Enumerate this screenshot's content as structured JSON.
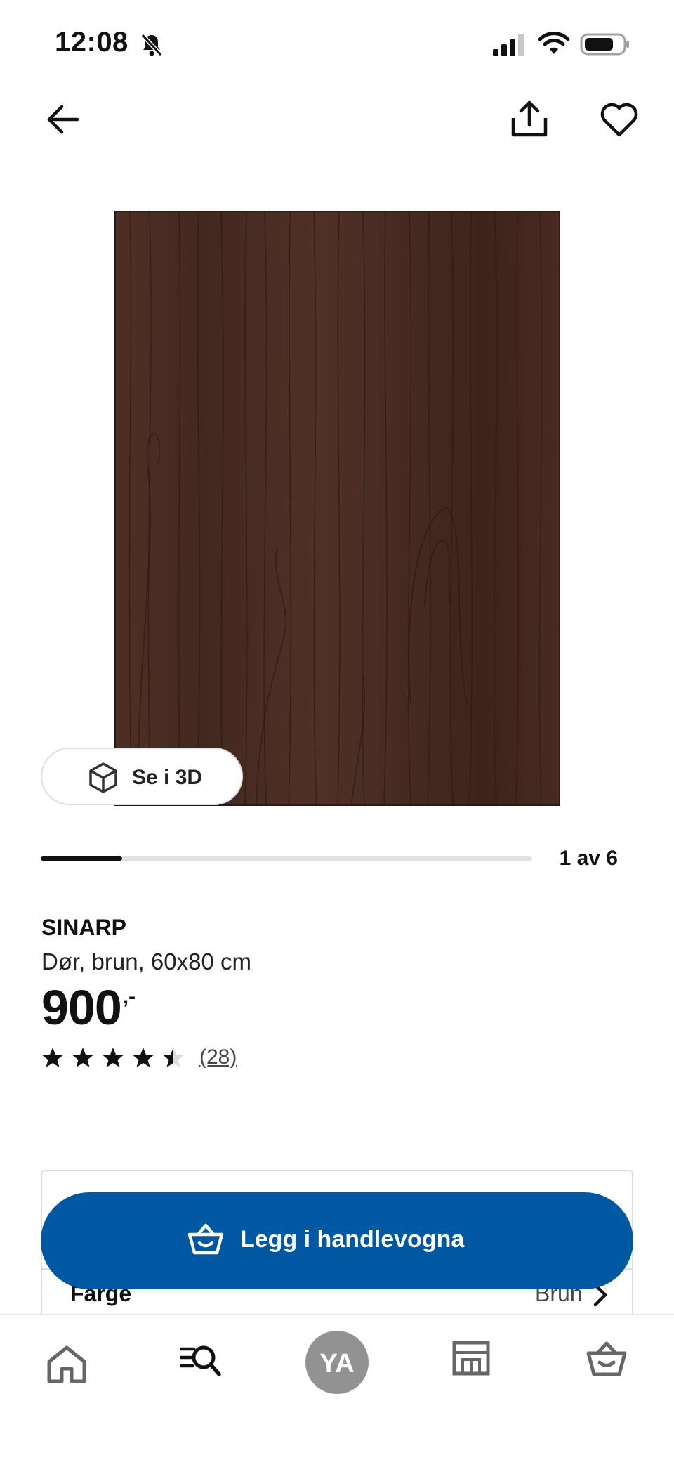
{
  "status_bar": {
    "time": "12:08"
  },
  "header": {
    "back_icon": "arrow-left-icon",
    "share_icon": "share-icon",
    "favorite_icon": "heart-icon"
  },
  "gallery": {
    "see_3d_label": "Se i 3D",
    "counter": "1 av 6",
    "current_index": 1,
    "total": 6
  },
  "product": {
    "name": "SINARP",
    "description": "Dør, brun, 60x80 cm",
    "price": "900",
    "price_suffix": ",-",
    "rating": 4.5,
    "rating_max": 5,
    "review_count": "(28)"
  },
  "cart": {
    "add_label": "Legg i handlevogna",
    "color_label": "Farge",
    "color_value": "Brun"
  },
  "bottom_nav": {
    "profile_initials": "YA",
    "items": [
      "home-icon",
      "search-icon",
      "profile-avatar",
      "store-icon",
      "cart-icon"
    ]
  },
  "colors": {
    "primary_blue": "#0058a3",
    "wood_brown": "#4a2c22",
    "avatar_grey": "#929292"
  }
}
